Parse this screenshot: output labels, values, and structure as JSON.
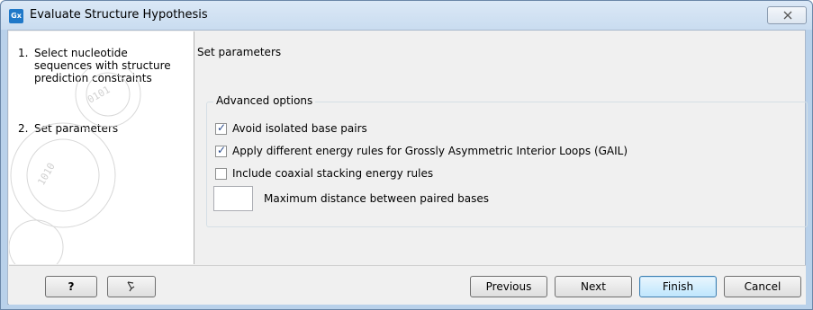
{
  "window": {
    "title": "Evaluate Structure Hypothesis",
    "icon_label": "Gx",
    "close_icon": "close-icon"
  },
  "steps": [
    {
      "number": "1.",
      "label": "Select nucleotide sequences with structure prediction constraints"
    },
    {
      "number": "2.",
      "label": "Set parameters"
    }
  ],
  "main": {
    "section_title": "Set parameters",
    "group_title": "Advanced options",
    "options": [
      {
        "label": "Avoid isolated base pairs",
        "checked": true
      },
      {
        "label": "Apply different energy rules for Grossly Asymmetric Interior Loops (GAIL)",
        "checked": true
      },
      {
        "label": "Include coaxial stacking energy rules",
        "checked": false
      }
    ],
    "max_distance": {
      "label": "Maximum distance between paired bases",
      "value": ""
    }
  },
  "buttons": {
    "help": "?",
    "reset_icon": "reset-arrow-icon",
    "previous": "Previous",
    "next": "Next",
    "finish": "Finish",
    "cancel": "Cancel"
  }
}
